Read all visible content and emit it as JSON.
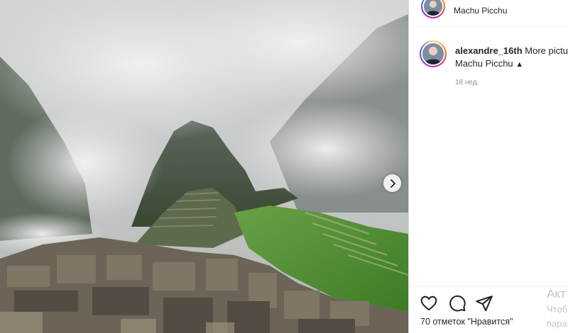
{
  "post": {
    "location": "Machu Picchu",
    "username": "alexandre_16th",
    "caption": "More pictu",
    "caption_line2": "Machu Picchu",
    "mountain_emoji": "▲",
    "time_ago": "18 нед.",
    "likes": "70 отметок \"Нравится\"",
    "more_icon": "more-dots-icon"
  },
  "photo": {
    "alt_subject": "Machu Picchu ruins in clouds",
    "next_icon": "chevron-right-icon"
  },
  "overlay": {
    "activate_title": "Акт",
    "activate_line2": "Чтоб",
    "activate_line3": "пара"
  },
  "colors": {
    "text": "#262626",
    "muted": "#8e8e8e",
    "border": "#dbdbdb",
    "grass": "#3f8a2c",
    "stone": "#6b6457"
  }
}
